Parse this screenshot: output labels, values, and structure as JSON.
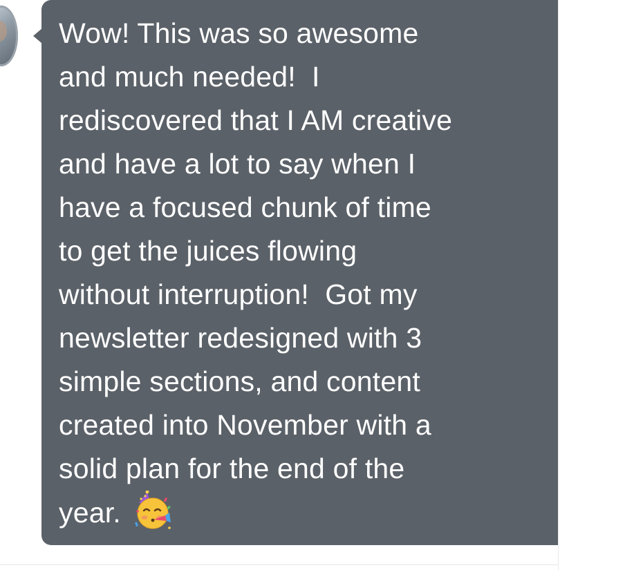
{
  "conversation": {
    "message": {
      "lines": [
        "Wow! This was so awesome",
        "and much needed!  I",
        "rediscovered that I AM creative",
        "and have a lot to say when I",
        "have a focused chunk of time",
        "to get the juices flowing",
        "without interruption!  Got my",
        "newsletter redesigned with 3",
        "simple sections, and content",
        "created into November with a",
        "solid plan for the end of the",
        "year."
      ],
      "emoji_icon": "partying-face-icon"
    },
    "colors": {
      "bubble": "#5b6168",
      "text": "#ffffff",
      "background": "#ffffff"
    }
  }
}
